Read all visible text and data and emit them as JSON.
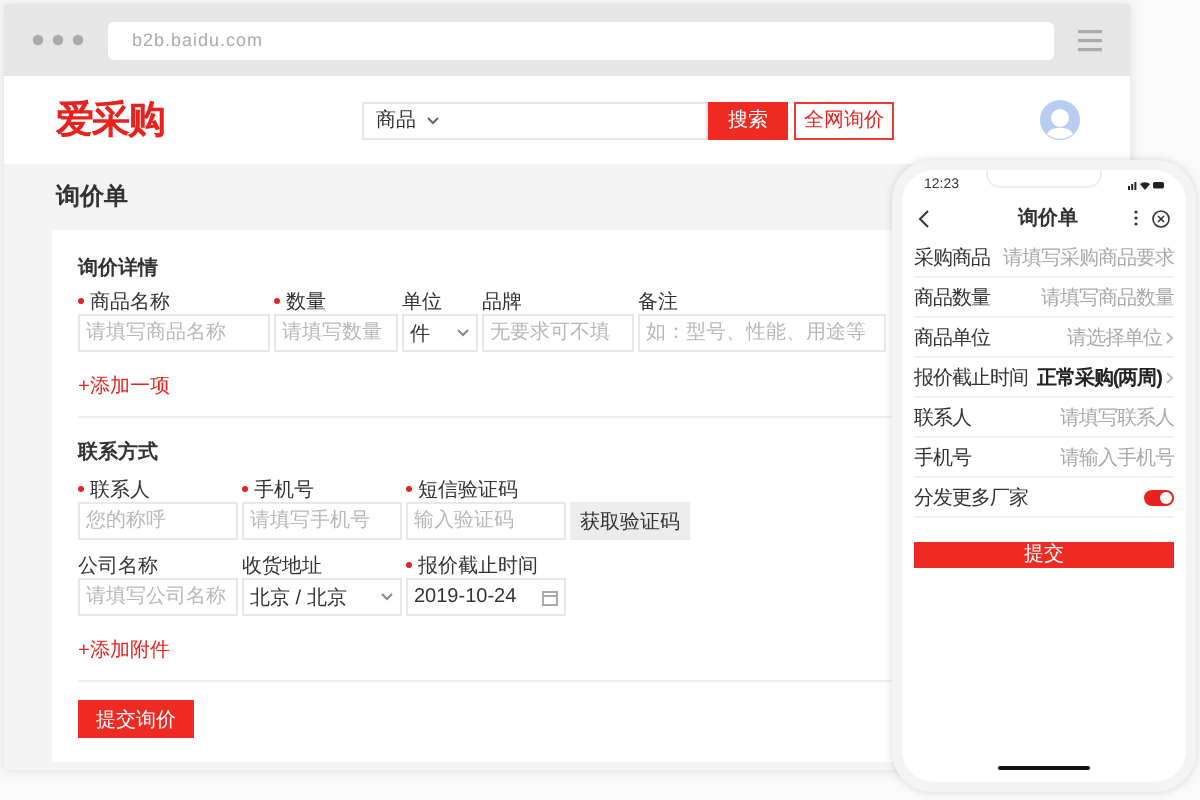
{
  "browser": {
    "url": "b2b.baidu.com"
  },
  "header": {
    "logo": "爱采购",
    "search_category": "商品",
    "search_button": "搜索",
    "inquiry_button": "全网询价"
  },
  "page_title": "询价单",
  "details": {
    "title": "询价详情",
    "fields": [
      {
        "label": "商品名称",
        "required": true,
        "kind": "input",
        "placeholder": "请填写商品名称"
      },
      {
        "label": "数量",
        "required": true,
        "kind": "input",
        "placeholder": "请填写数量"
      },
      {
        "label": "单位",
        "required": false,
        "kind": "select",
        "value": "件"
      },
      {
        "label": "品牌",
        "required": false,
        "kind": "input",
        "placeholder": "无要求可不填"
      },
      {
        "label": "备注",
        "required": false,
        "kind": "input",
        "placeholder": "如：型号、性能、用途等"
      }
    ],
    "add_link": "+添加一项"
  },
  "contact": {
    "title": "联系方式",
    "rows": [
      [
        {
          "label": "联系人",
          "required": true,
          "kind": "input",
          "placeholder": "您的称呼"
        },
        {
          "label": "手机号",
          "required": true,
          "kind": "input",
          "placeholder": "请填写手机号"
        },
        {
          "label": "短信验证码",
          "required": true,
          "kind": "input",
          "placeholder": "输入验证码"
        },
        {
          "kind": "button",
          "text": "获取验证码"
        }
      ],
      [
        {
          "label": "公司名称",
          "required": false,
          "kind": "input",
          "placeholder": "请填写公司名称"
        },
        {
          "label": "收货地址",
          "required": false,
          "kind": "select",
          "value": "北京 / 北京"
        },
        {
          "label": "报价截止时间",
          "required": true,
          "kind": "date",
          "value": "2019-10-24"
        }
      ]
    ],
    "add_link": "+添加附件"
  },
  "submit": "提交询价",
  "phone": {
    "time": "12:23",
    "title": "询价单",
    "rows": [
      {
        "label": "采购商品",
        "kind": "input",
        "placeholder": "请填写采购商品要求"
      },
      {
        "label": "商品数量",
        "kind": "input",
        "placeholder": "请填写商品数量"
      },
      {
        "label": "商品单位",
        "kind": "picker",
        "placeholder": "请选择单位"
      },
      {
        "label": "报价截止时间",
        "kind": "picker",
        "value": "正常采购(两周)"
      },
      {
        "label": "联系人",
        "kind": "input",
        "placeholder": "请填写联系人"
      },
      {
        "label": "手机号",
        "kind": "input",
        "placeholder": "请输入手机号"
      },
      {
        "label": "分发更多厂家",
        "kind": "toggle",
        "on": true
      }
    ],
    "submit": "提交"
  }
}
